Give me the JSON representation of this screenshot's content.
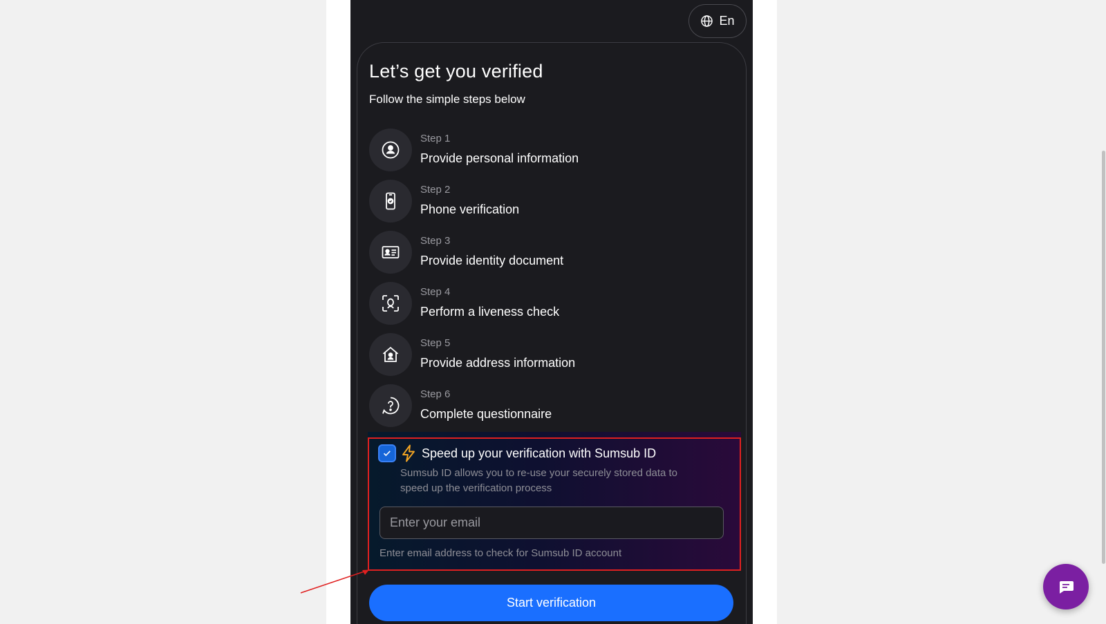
{
  "header": {
    "language_label": "En"
  },
  "intro": {
    "title": "Let’s get you verified",
    "subtitle": "Follow the simple steps below"
  },
  "steps": [
    {
      "number": "Step 1",
      "label": "Provide personal information",
      "icon": "person-circle-icon"
    },
    {
      "number": "Step 2",
      "label": "Phone verification",
      "icon": "phone-check-icon"
    },
    {
      "number": "Step 3",
      "label": "Provide identity document",
      "icon": "id-card-icon"
    },
    {
      "number": "Step 4",
      "label": "Perform a liveness check",
      "icon": "face-scan-icon"
    },
    {
      "number": "Step 5",
      "label": "Provide address information",
      "icon": "home-person-icon"
    },
    {
      "number": "Step 6",
      "label": "Complete questionnaire",
      "icon": "question-circle-icon"
    }
  ],
  "sumsub": {
    "checked": true,
    "title": "Speed up your verification with Sumsub ID",
    "description": "Sumsub ID allows you to re-use your securely stored data to speed up the verification process",
    "email_placeholder": "Enter your email",
    "email_value": "",
    "hint": "Enter email address to check for Sumsub ID account"
  },
  "actions": {
    "start_label": "Start verification"
  },
  "colors": {
    "accent": "#1a6fff",
    "panel": "#1b1b1f",
    "highlight_outline": "#e02020",
    "chat": "#7b1fa2"
  }
}
